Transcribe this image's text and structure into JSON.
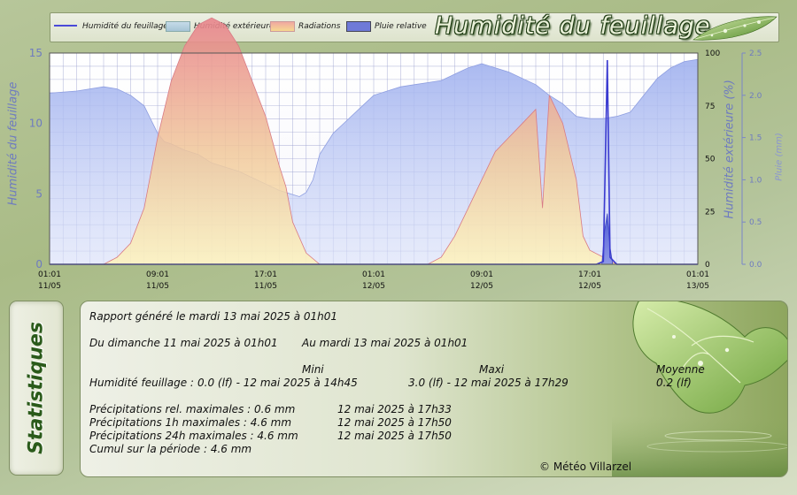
{
  "legend": {
    "items": [
      {
        "label": "Humidité du feuillage",
        "color": "#4a4ad8",
        "kind": "line"
      },
      {
        "label": "Humidité extérieure",
        "color": "#a9b8e8",
        "kind": "area"
      },
      {
        "label": "Radiations",
        "color": "#e89aa0",
        "kind": "area"
      },
      {
        "label": "Pluie relative",
        "color": "#5a68d8",
        "kind": "area"
      }
    ]
  },
  "header": {
    "brand_title": "Humidité du feuillage"
  },
  "chart_data": {
    "type": "area",
    "x_ticks": [
      {
        "time": "01:01",
        "date": "11/05"
      },
      {
        "time": "09:01",
        "date": "11/05"
      },
      {
        "time": "17:01",
        "date": "11/05"
      },
      {
        "time": "01:01",
        "date": "12/05"
      },
      {
        "time": "09:01",
        "date": "12/05"
      },
      {
        "time": "17:01",
        "date": "12/05"
      },
      {
        "time": "01:01",
        "date": "13/05"
      }
    ],
    "x_range_hours": [
      0,
      48
    ],
    "y_left": {
      "label": "Humidité du feuillage",
      "range": [
        0,
        15
      ],
      "ticks": [
        "0",
        "5",
        "10",
        "15"
      ]
    },
    "y_right1": {
      "label": "Humidité extérieure (%)",
      "range": [
        0,
        100
      ],
      "ticks": [
        "0",
        "25",
        "50",
        "75",
        "100"
      ]
    },
    "y_right2": {
      "label": "Pluie (mm)",
      "range": [
        0,
        2.5
      ],
      "ticks": [
        "0.0",
        "0.5",
        "1.0",
        "1.5",
        "2.0",
        "2.5"
      ]
    },
    "grid": true,
    "series": [
      {
        "name": "Humidité extérieure",
        "axis": "y_right1",
        "points": [
          [
            0,
            81
          ],
          [
            2,
            82
          ],
          [
            4,
            84
          ],
          [
            5,
            83
          ],
          [
            6,
            80
          ],
          [
            7,
            75
          ],
          [
            8,
            62
          ],
          [
            8.5,
            58
          ],
          [
            9,
            57
          ],
          [
            10,
            54
          ],
          [
            11,
            52
          ],
          [
            12,
            48
          ],
          [
            13,
            46
          ],
          [
            14,
            44
          ],
          [
            15,
            41
          ],
          [
            16,
            38
          ],
          [
            17,
            35
          ],
          [
            18,
            33
          ],
          [
            18.5,
            32
          ],
          [
            19,
            34
          ],
          [
            19.5,
            40
          ],
          [
            20,
            52
          ],
          [
            21,
            62
          ],
          [
            22,
            68
          ],
          [
            23,
            74
          ],
          [
            24,
            80
          ],
          [
            25,
            82
          ],
          [
            26,
            84
          ],
          [
            27,
            85
          ],
          [
            28,
            86
          ],
          [
            29,
            87
          ],
          [
            30,
            90
          ],
          [
            31,
            93
          ],
          [
            32,
            95
          ],
          [
            33,
            93
          ],
          [
            34,
            91
          ],
          [
            35,
            88
          ],
          [
            36,
            85
          ],
          [
            37,
            80
          ],
          [
            38,
            76
          ],
          [
            39,
            70
          ],
          [
            40,
            69
          ],
          [
            41,
            69
          ],
          [
            42,
            70
          ],
          [
            43,
            72
          ],
          [
            44,
            80
          ],
          [
            45,
            88
          ],
          [
            46,
            93
          ],
          [
            47,
            96
          ],
          [
            48,
            97
          ]
        ]
      },
      {
        "name": "Radiations",
        "relative_scale": "y_left",
        "points": [
          [
            0,
            0
          ],
          [
            4,
            0
          ],
          [
            5,
            0.5
          ],
          [
            6,
            1.5
          ],
          [
            7,
            4
          ],
          [
            8,
            9
          ],
          [
            9,
            13
          ],
          [
            10,
            15.5
          ],
          [
            11,
            17
          ],
          [
            12,
            17.5
          ],
          [
            13,
            17
          ],
          [
            14,
            15.5
          ],
          [
            15,
            13
          ],
          [
            16,
            10.5
          ],
          [
            17,
            7
          ],
          [
            17.5,
            5.5
          ],
          [
            18,
            3
          ],
          [
            19,
            0.8
          ],
          [
            20,
            0
          ],
          [
            24,
            0
          ],
          [
            28,
            0
          ],
          [
            29,
            0.5
          ],
          [
            30,
            2
          ],
          [
            31,
            4
          ],
          [
            32,
            6
          ],
          [
            33,
            8
          ],
          [
            34,
            9
          ],
          [
            35,
            10
          ],
          [
            36,
            11
          ],
          [
            36.5,
            4
          ],
          [
            37,
            12
          ],
          [
            38,
            10
          ],
          [
            39,
            6
          ],
          [
            39.5,
            2
          ],
          [
            40,
            1
          ],
          [
            41,
            0.5
          ],
          [
            42,
            0
          ],
          [
            48,
            0
          ]
        ]
      },
      {
        "name": "Humidité du feuillage",
        "axis": "y_left",
        "points": [
          [
            0,
            0
          ],
          [
            40.5,
            0
          ],
          [
            41,
            0.2
          ],
          [
            41.3,
            14.5
          ],
          [
            41.5,
            0.5
          ],
          [
            42,
            0
          ],
          [
            48,
            0
          ]
        ]
      },
      {
        "name": "Pluie relative",
        "axis": "y_right2",
        "points": [
          [
            0,
            0
          ],
          [
            40.9,
            0
          ],
          [
            41.1,
            0.4
          ],
          [
            41.3,
            0.6
          ],
          [
            41.5,
            0.2
          ],
          [
            41.7,
            0
          ],
          [
            48,
            0
          ]
        ]
      }
    ]
  },
  "stats": {
    "tab_label": "Statistiques",
    "report_line": "Rapport généré le mardi 13 mai 2025 à 01h01",
    "period_from": "Du dimanche 11 mai 2025 à 01h01",
    "period_to": "Au mardi 13 mai 2025 à 01h01",
    "col_min": "Mini",
    "col_max": "Maxi",
    "col_avg": "Moyenne",
    "row_label": "Humidité feuillage :",
    "row_min": "0.0 (lf) - 12 mai 2025 à 14h45",
    "row_max": "3.0 (lf) - 12 mai 2025 à 17h29",
    "row_avg": "0.2 (lf)",
    "precip_rel": "Précipitations rel. maximales : 0.6 mm",
    "precip_rel_date": "12 mai 2025 à 17h33",
    "precip_1h": "Précipitations 1h maximales : 4.6 mm",
    "precip_1h_date": "12 mai 2025 à 17h50",
    "precip_24h": "Précipitations 24h maximales : 4.6 mm",
    "precip_24h_date": "12 mai 2025 à 17h50",
    "cumul": "Cumul sur la période : 4.6 mm",
    "copyright": "© Météo Villarzel"
  }
}
